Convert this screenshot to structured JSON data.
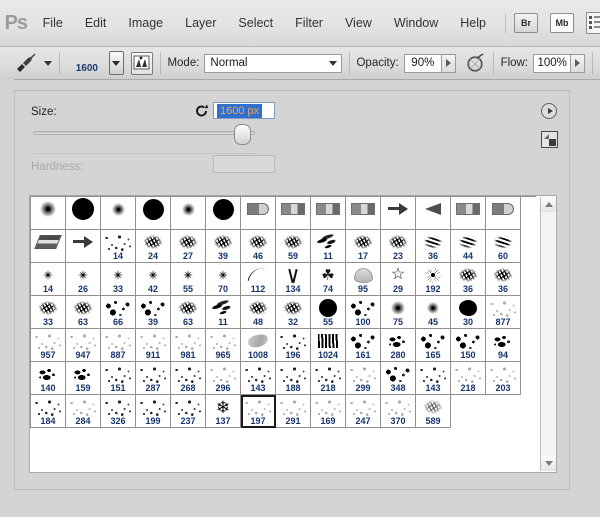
{
  "app": {
    "logo": "Ps",
    "title": "Adobe Photoshop"
  },
  "menubar": {
    "items": [
      {
        "label": "File"
      },
      {
        "label": "Edit"
      },
      {
        "label": "Image"
      },
      {
        "label": "Layer"
      },
      {
        "label": "Select"
      },
      {
        "label": "Filter"
      },
      {
        "label": "View"
      },
      {
        "label": "Window"
      },
      {
        "label": "Help"
      }
    ],
    "right_buttons": [
      {
        "label": "Br",
        "name": "bridge-button"
      },
      {
        "label": "Mb",
        "name": "mini-bridge-button"
      }
    ]
  },
  "options_bar": {
    "brush_size_preview": "1600",
    "mode_label": "Mode:",
    "mode_value": "Normal",
    "opacity_label": "Opacity:",
    "opacity_value": "90%",
    "flow_label": "Flow:",
    "flow_value": "100%"
  },
  "brush_panel": {
    "size_label": "Size:",
    "size_value": "1600 px",
    "hardness_label": "Hardness:",
    "hardness_value": "",
    "selected_preset": "197",
    "selection_colors": {
      "highlight_bg": "#2f6fcf",
      "highlight_text": "#f0a858",
      "number_color": "#16336b"
    },
    "grid": {
      "columns": 14,
      "rows": [
        [
          {
            "num": "",
            "shape": "dot-soft",
            "size": 16
          },
          {
            "num": "",
            "shape": "dot-hard",
            "size": 22
          },
          {
            "num": "",
            "shape": "dot-soft",
            "size": 13
          },
          {
            "num": "",
            "shape": "dot-hard",
            "size": 21
          },
          {
            "num": "",
            "shape": "dot-soft",
            "size": 13
          },
          {
            "num": "",
            "shape": "dot-hard",
            "size": 21
          },
          {
            "num": "",
            "shape": "round-tip"
          },
          {
            "num": "",
            "shape": "flat-tip"
          },
          {
            "num": "",
            "shape": "flat-tip"
          },
          {
            "num": "",
            "shape": "flat-tip"
          },
          {
            "num": "",
            "shape": "speaker"
          },
          {
            "num": "",
            "shape": "cone-tip"
          },
          {
            "num": "",
            "shape": "flat-tip"
          },
          {
            "num": "",
            "shape": "round-tip"
          }
        ],
        [
          {
            "num": "",
            "shape": "ribbon"
          },
          {
            "num": "",
            "shape": "speaker"
          },
          {
            "num": "14",
            "shape": "speckle"
          },
          {
            "num": "24",
            "shape": "grunge"
          },
          {
            "num": "27",
            "shape": "grunge"
          },
          {
            "num": "39",
            "shape": "grunge"
          },
          {
            "num": "46",
            "shape": "grunge"
          },
          {
            "num": "59",
            "shape": "grunge"
          },
          {
            "num": "11",
            "shape": "scratch"
          },
          {
            "num": "17",
            "shape": "grunge"
          },
          {
            "num": "23",
            "shape": "grunge"
          },
          {
            "num": "36",
            "shape": "lines"
          },
          {
            "num": "44",
            "shape": "lines"
          },
          {
            "num": "60",
            "shape": "lines"
          }
        ],
        [
          {
            "num": "14",
            "shape": "tiny-star"
          },
          {
            "num": "26",
            "shape": "tiny-star"
          },
          {
            "num": "33",
            "shape": "tiny-star"
          },
          {
            "num": "42",
            "shape": "tiny-star"
          },
          {
            "num": "55",
            "shape": "tiny-star"
          },
          {
            "num": "70",
            "shape": "tiny-star"
          },
          {
            "num": "112",
            "shape": "arc"
          },
          {
            "num": "134",
            "shape": "grass"
          },
          {
            "num": "74",
            "shape": "leaf"
          },
          {
            "num": "95",
            "shape": "shell"
          },
          {
            "num": "29",
            "shape": "star-out"
          },
          {
            "num": "192",
            "shape": "burst"
          },
          {
            "num": "36",
            "shape": "grunge"
          },
          {
            "num": "36",
            "shape": "grunge"
          }
        ],
        [
          {
            "num": "33",
            "shape": "grunge"
          },
          {
            "num": "63",
            "shape": "grunge"
          },
          {
            "num": "66",
            "shape": "speckle big"
          },
          {
            "num": "39",
            "shape": "speckle big"
          },
          {
            "num": "63",
            "shape": "grunge"
          },
          {
            "num": "11",
            "shape": "scratch"
          },
          {
            "num": "48",
            "shape": "grunge"
          },
          {
            "num": "32",
            "shape": "grunge"
          },
          {
            "num": "55",
            "shape": "dot-hard",
            "size": 18
          },
          {
            "num": "100",
            "shape": "speckle big"
          },
          {
            "num": "75",
            "shape": "dot-soft",
            "size": 14
          },
          {
            "num": "45",
            "shape": "dot-soft",
            "size": 12
          },
          {
            "num": "30",
            "shape": "blob"
          },
          {
            "num": "877",
            "shape": "speckle faint"
          }
        ],
        [
          {
            "num": "957",
            "shape": "speckle faint"
          },
          {
            "num": "947",
            "shape": "speckle faint"
          },
          {
            "num": "887",
            "shape": "speckle faint"
          },
          {
            "num": "911",
            "shape": "speckle faint"
          },
          {
            "num": "981",
            "shape": "speckle faint"
          },
          {
            "num": "965",
            "shape": "speckle faint"
          },
          {
            "num": "1008",
            "shape": "smudge"
          },
          {
            "num": "196",
            "shape": "speckle"
          },
          {
            "num": "1024",
            "shape": "brushstroke"
          },
          {
            "num": "161",
            "shape": "speckle big"
          },
          {
            "num": "280",
            "shape": "blobs-small"
          },
          {
            "num": "165",
            "shape": "speckle big"
          },
          {
            "num": "150",
            "shape": "speckle big"
          },
          {
            "num": "94",
            "shape": "blobs-small"
          }
        ],
        [
          {
            "num": "140",
            "shape": "blobs-small"
          },
          {
            "num": "159",
            "shape": "blobs-small"
          },
          {
            "num": "151",
            "shape": "speckle"
          },
          {
            "num": "287",
            "shape": "speckle"
          },
          {
            "num": "268",
            "shape": "speckle"
          },
          {
            "num": "296",
            "shape": "speckle faint"
          },
          {
            "num": "143",
            "shape": "speckle"
          },
          {
            "num": "188",
            "shape": "speckle"
          },
          {
            "num": "218",
            "shape": "speckle"
          },
          {
            "num": "299",
            "shape": "speckle faint"
          },
          {
            "num": "348",
            "shape": "speckle big"
          },
          {
            "num": "143",
            "shape": "speckle"
          },
          {
            "num": "218",
            "shape": "speckle faint"
          },
          {
            "num": "203",
            "shape": "speckle faint"
          }
        ],
        [
          {
            "num": "184",
            "shape": "speckle"
          },
          {
            "num": "284",
            "shape": "speckle faint"
          },
          {
            "num": "326",
            "shape": "speckle"
          },
          {
            "num": "199",
            "shape": "speckle"
          },
          {
            "num": "237",
            "shape": "speckle"
          },
          {
            "num": "137",
            "shape": "snow"
          },
          {
            "num": "197",
            "shape": "speckle faint",
            "selected": true
          },
          {
            "num": "291",
            "shape": "speckle faint"
          },
          {
            "num": "169",
            "shape": "speckle faint"
          },
          {
            "num": "247",
            "shape": "speckle faint"
          },
          {
            "num": "370",
            "shape": "speckle faint"
          },
          {
            "num": "589",
            "shape": "grunge light"
          }
        ]
      ]
    }
  }
}
